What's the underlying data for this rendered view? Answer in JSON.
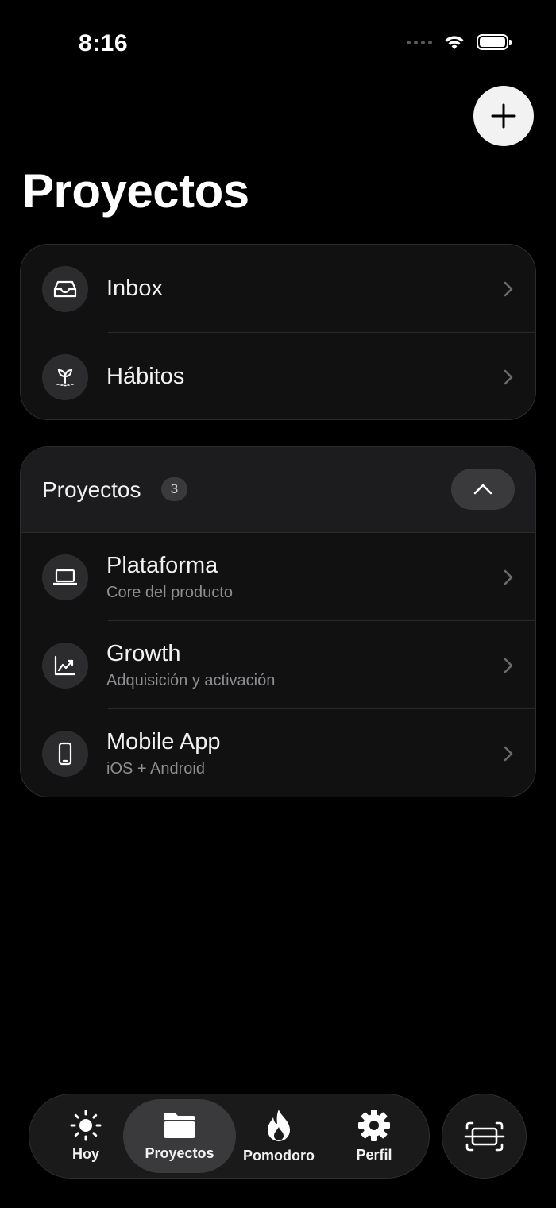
{
  "status_bar": {
    "time": "8:16"
  },
  "page": {
    "title": "Proyectos"
  },
  "quick_list": [
    {
      "label": "Inbox",
      "icon": "inbox-icon"
    },
    {
      "label": "Hábitos",
      "icon": "sprout-icon"
    }
  ],
  "projects_section": {
    "title": "Proyectos",
    "count": "3",
    "items": [
      {
        "title": "Plataforma",
        "subtitle": "Core del producto",
        "icon": "laptop-icon"
      },
      {
        "title": "Growth",
        "subtitle": "Adquisición y activación",
        "icon": "chart-icon"
      },
      {
        "title": "Mobile App",
        "subtitle": "iOS + Android",
        "icon": "phone-icon"
      }
    ]
  },
  "tab_bar": {
    "tabs": [
      {
        "label": "Hoy",
        "icon": "sun-icon",
        "active": false
      },
      {
        "label": "Proyectos",
        "icon": "folder-icon",
        "active": true
      },
      {
        "label": "Pomodoro",
        "icon": "flame-icon",
        "active": false
      },
      {
        "label": "Perfil",
        "icon": "gear-icon",
        "active": false
      }
    ]
  },
  "colors": {
    "background": "#000000",
    "card": "#111111",
    "icon_circle": "#2c2c2e",
    "active_tab": "#3a3a3c"
  }
}
